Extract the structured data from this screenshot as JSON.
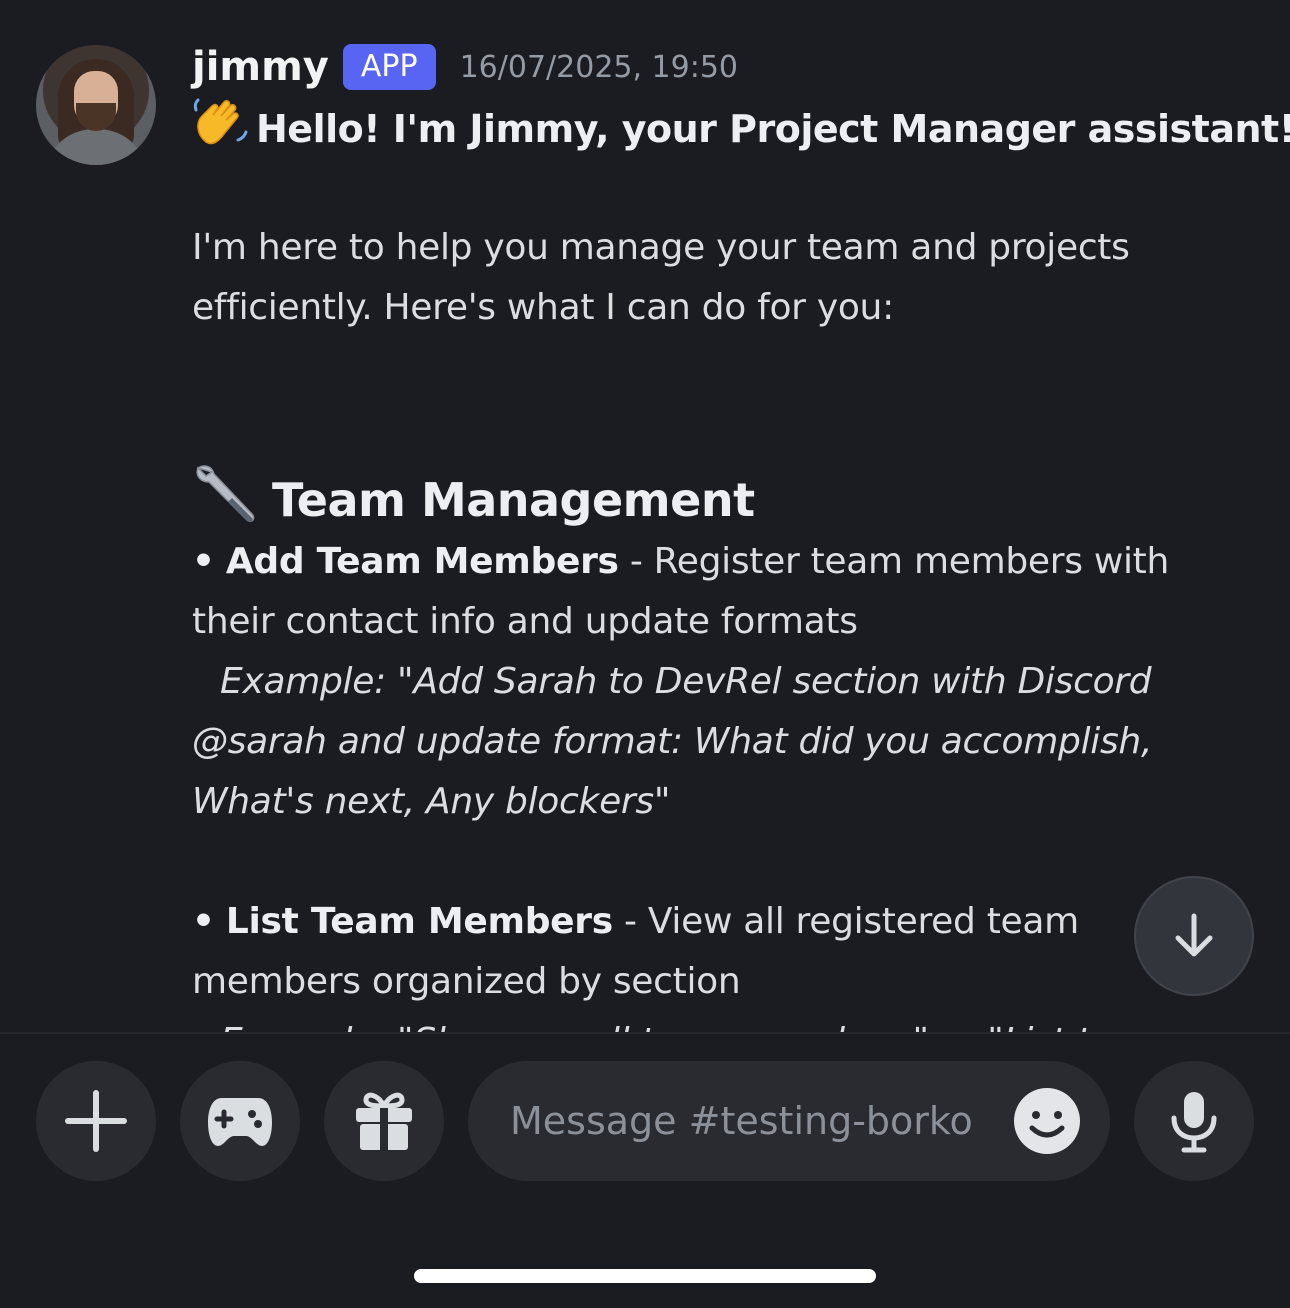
{
  "message": {
    "username": "jimmy",
    "badge": "APP",
    "timestamp": "16/07/2025, 19:50",
    "greeting": "Hello! I'm Jimmy, your Project Manager assistant!",
    "intro_line1": "I'm here to help you manage your team and projects",
    "intro_line2": "efficiently. Here's what I can do for you:",
    "section_heading": "Team Management",
    "item1_bullet": "•",
    "item1_title": "Add Team Members",
    "item1_desc_a": " - Register team members with",
    "item1_desc_b": "their contact info and update formats",
    "item1_example_a": "Example: \"Add Sarah to DevRel section with Discord",
    "item1_example_b": "@sarah and update format: What did you accomplish,",
    "item1_example_c": "What's next, Any blockers\"",
    "item2_bullet": "•",
    "item2_title": "List Team Members",
    "item2_desc_a": " - View all registered team",
    "item2_desc_b": "members organized by section",
    "item2_example_a": "Example: \"Show me all team members\" or \"List team"
  },
  "composer": {
    "placeholder": "Message #testing-borko"
  },
  "icons": {
    "scroll_down": "arrow-down-icon",
    "add": "plus-icon",
    "apps": "gamepad-icon",
    "gift": "gift-icon",
    "emoji": "smile-icon",
    "voice": "microphone-icon"
  },
  "colors": {
    "background": "#1b1c21",
    "badge": "#5865f2",
    "button": "#2a2b31"
  }
}
